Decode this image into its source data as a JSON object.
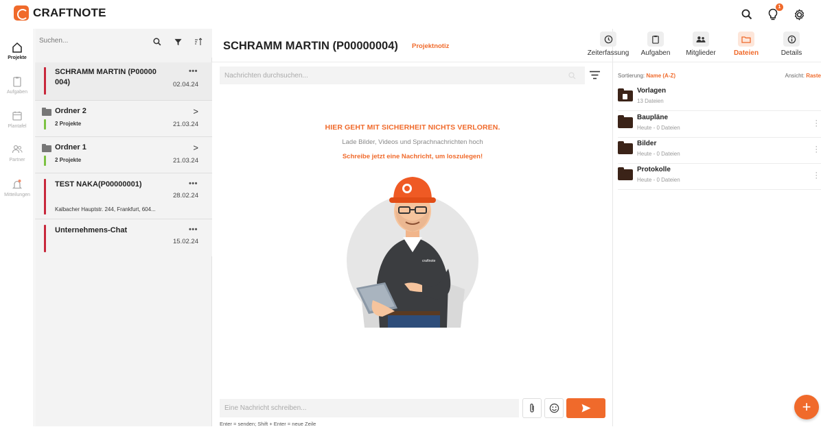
{
  "app": {
    "name": "CRAFTNOTE",
    "brand_color": "#f06a2b"
  },
  "topbar": {
    "notification_count": "1"
  },
  "nav": {
    "items": [
      {
        "label": "Projekte",
        "icon": "home-icon",
        "active": true
      },
      {
        "label": "Aufgaben",
        "icon": "clipboard-icon"
      },
      {
        "label": "Plantafel",
        "icon": "calendar-icon"
      },
      {
        "label": "Partner",
        "icon": "people-icon"
      },
      {
        "label": "Mitteilungen",
        "icon": "bell-icon"
      }
    ]
  },
  "projects": {
    "search_placeholder": "Suchen...",
    "items": [
      {
        "title": "SCHRAMM MARTIN (P00000\n004)",
        "date": "02.04.24",
        "dots": "•••"
      },
      {
        "title": "Ordner 2",
        "sub": "2 Projekte",
        "date": "21.03.24"
      },
      {
        "title": "Ordner 1",
        "sub": "2 Projekte",
        "date": "21.03.24"
      },
      {
        "title": "TEST NAKA(P00000001)",
        "sub": "Kalbacher Hauptstr. 244, Frankfurt, 604...",
        "date": "28.02.24",
        "dots": "•••"
      },
      {
        "title": "Unternehmens-Chat",
        "date": "15.02.24",
        "dots": "•••"
      }
    ]
  },
  "chat": {
    "title": "SCHRAMM MARTIN (P00000004)",
    "tag": "Projektnotiz",
    "search_placeholder": "Nachrichten durchsuchen...",
    "empty_heading": "HIER GEHT MIT SICHERHEIT NICHTS VERLOREN.",
    "empty_sub": "Lade Bilder, Videos und Sprachnachrichten hoch",
    "empty_cta": "Schreibe jetzt eine Nachricht, um loszulegen!",
    "compose_placeholder": "Eine Nachricht schreiben...",
    "hint": "Enter = senden; Shift + Enter = neue Zeile"
  },
  "tabs": [
    {
      "label": "Zeiterfassung",
      "icon": "clock-icon"
    },
    {
      "label": "Aufgaben",
      "icon": "clipboard-icon"
    },
    {
      "label": "Mitglieder",
      "icon": "members-icon"
    },
    {
      "label": "Dateien",
      "icon": "folder-icon",
      "active": true
    },
    {
      "label": "Details",
      "icon": "info-icon"
    }
  ],
  "files": {
    "sort_label": "Sortierung:",
    "sort_value": "Name (A-Z)",
    "view_label": "Ansicht:",
    "view_value": "Raste",
    "items": [
      {
        "name": "Vorlagen",
        "sub": "13 Dateien"
      },
      {
        "name": "Baupläne",
        "sub": "Heute - 0 Dateien"
      },
      {
        "name": "Bilder",
        "sub": "Heute - 0 Dateien"
      },
      {
        "name": "Protokolle",
        "sub": "Heute - 0 Dateien"
      }
    ]
  },
  "fab_label": "+"
}
